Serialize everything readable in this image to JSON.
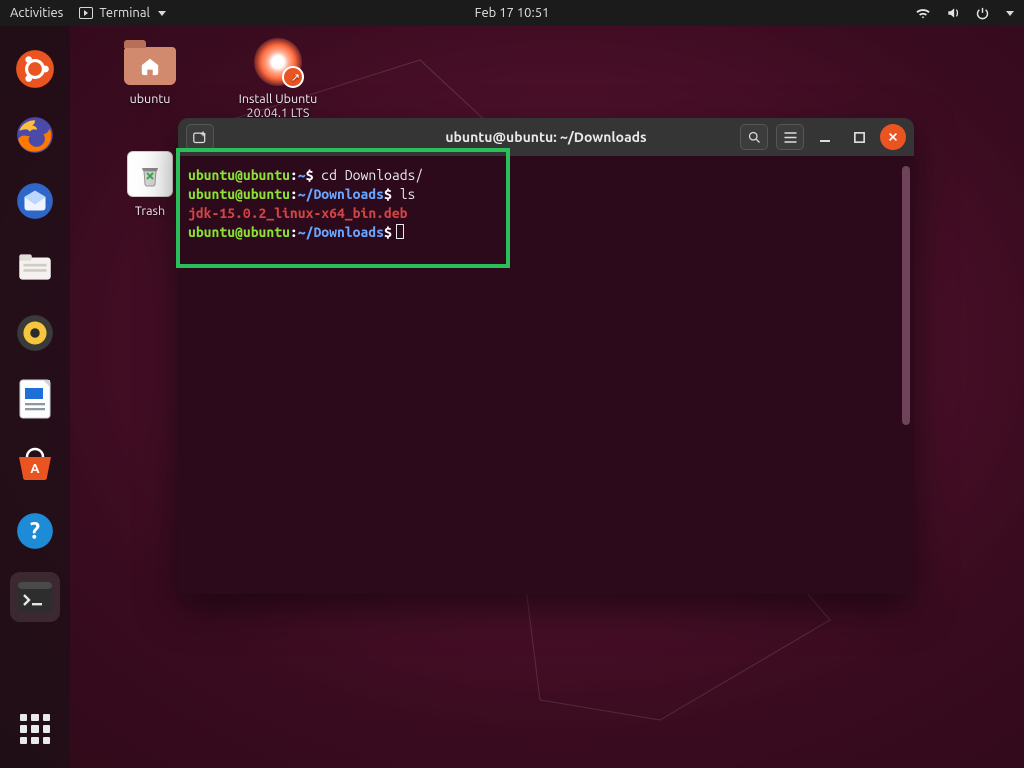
{
  "topbar": {
    "activities": "Activities",
    "app_name": "Terminal",
    "datetime": "Feb 17  10:51"
  },
  "desktop": {
    "home_label": "ubuntu",
    "install_label_line1": "Install Ubuntu",
    "install_label_line2": "20.04.1 LTS",
    "trash_label": "Trash"
  },
  "terminal": {
    "title": "ubuntu@ubuntu: ~/Downloads",
    "lines": {
      "l1": {
        "userhost": "ubuntu@ubuntu",
        "sep": ":",
        "path": "~",
        "prompt": "$",
        "cmd": " cd Downloads/"
      },
      "l2": {
        "userhost": "ubuntu@ubuntu",
        "sep": ":",
        "path": "~/Downloads",
        "prompt": "$",
        "cmd": " ls"
      },
      "l3": {
        "file": "jdk-15.0.2_linux-x64_bin.deb"
      },
      "l4": {
        "userhost": "ubuntu@ubuntu",
        "sep": ":",
        "path": "~/Downloads",
        "prompt": "$",
        "cmd": ""
      }
    }
  }
}
